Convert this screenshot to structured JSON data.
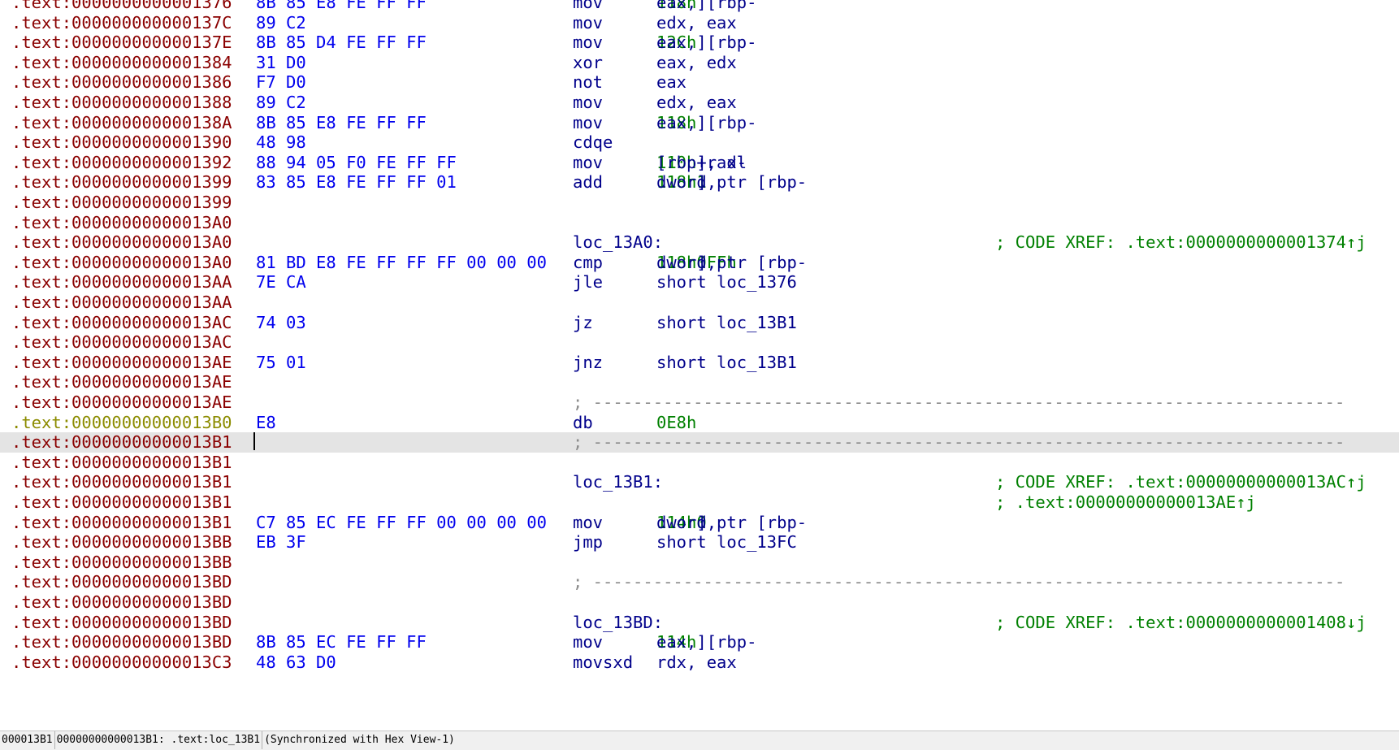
{
  "listing": {
    "rows": [
      {
        "addr": ".text:0000000000001376",
        "bytes": "8B 85 E8 FE FF FF",
        "mnem": "mov",
        "ops": [
          [
            "eax, [rbp-",
            ""
          ],
          [
            "118h",
            "num"
          ],
          [
            "]",
            ""
          ]
        ]
      },
      {
        "addr": ".text:000000000000137C",
        "bytes": "89 C2",
        "mnem": "mov",
        "ops": [
          [
            "edx, eax",
            ""
          ]
        ]
      },
      {
        "addr": ".text:000000000000137E",
        "bytes": "8B 85 D4 FE FF FF",
        "mnem": "mov",
        "ops": [
          [
            "eax, [rbp-",
            ""
          ],
          [
            "12Ch",
            "num"
          ],
          [
            "]",
            ""
          ]
        ]
      },
      {
        "addr": ".text:0000000000001384",
        "bytes": "31 D0",
        "mnem": "xor",
        "ops": [
          [
            "eax, edx",
            ""
          ]
        ]
      },
      {
        "addr": ".text:0000000000001386",
        "bytes": "F7 D0",
        "mnem": "not",
        "ops": [
          [
            "eax",
            ""
          ]
        ]
      },
      {
        "addr": ".text:0000000000001388",
        "bytes": "89 C2",
        "mnem": "mov",
        "ops": [
          [
            "edx, eax",
            ""
          ]
        ]
      },
      {
        "addr": ".text:000000000000138A",
        "bytes": "8B 85 E8 FE FF FF",
        "mnem": "mov",
        "ops": [
          [
            "eax, [rbp-",
            ""
          ],
          [
            "118h",
            "num"
          ],
          [
            "]",
            ""
          ]
        ]
      },
      {
        "addr": ".text:0000000000001390",
        "bytes": "48 98",
        "mnem": "cdqe"
      },
      {
        "addr": ".text:0000000000001392",
        "bytes": "88 94 05 F0 FE FF FF",
        "mnem": "mov",
        "ops": [
          [
            "[rbp+rax-",
            ""
          ],
          [
            "110h",
            "num"
          ],
          [
            "], dl",
            ""
          ]
        ]
      },
      {
        "addr": ".text:0000000000001399",
        "bytes": "83 85 E8 FE FF FF 01",
        "mnem": "add",
        "ops": [
          [
            "dword ptr [rbp-",
            ""
          ],
          [
            "118h",
            "num"
          ],
          [
            "], ",
            ""
          ],
          [
            "1",
            "num"
          ]
        ]
      },
      {
        "addr": ".text:0000000000001399"
      },
      {
        "addr": ".text:00000000000013A0"
      },
      {
        "addr": ".text:00000000000013A0",
        "mnem": "loc_13A0:",
        "comment": "; CODE XREF: .text:0000000000001374↑j"
      },
      {
        "addr": ".text:00000000000013A0",
        "bytes": "81 BD E8 FE FF FF FF 00 00 00",
        "mnem": "cmp",
        "ops": [
          [
            "dword ptr [rbp-",
            ""
          ],
          [
            "118h",
            "num"
          ],
          [
            "], ",
            ""
          ],
          [
            "0FFh",
            "num"
          ]
        ]
      },
      {
        "addr": ".text:00000000000013AA",
        "bytes": "7E CA",
        "mnem": "jle",
        "ops": [
          [
            "short loc_1376",
            ""
          ]
        ]
      },
      {
        "addr": ".text:00000000000013AA"
      },
      {
        "addr": ".text:00000000000013AC",
        "bytes": "74 03",
        "mnem": "jz",
        "ops": [
          [
            "short loc_13B1",
            ""
          ]
        ]
      },
      {
        "addr": ".text:00000000000013AC"
      },
      {
        "addr": ".text:00000000000013AE",
        "bytes": "75 01",
        "mnem": "jnz",
        "ops": [
          [
            "short loc_13B1",
            ""
          ]
        ]
      },
      {
        "addr": ".text:00000000000013AE"
      },
      {
        "addr": ".text:00000000000013AE",
        "sep": "; ---------------------------------------------------------------------------"
      },
      {
        "addr": ".text:00000000000013B0",
        "bytes": "E8",
        "mnem": "db",
        "ops": [
          [
            "0E8h",
            "num"
          ]
        ],
        "style": "yel"
      },
      {
        "addr": ".text:00000000000013B1",
        "sep": "; ---------------------------------------------------------------------------",
        "style": "hl"
      },
      {
        "addr": ".text:00000000000013B1"
      },
      {
        "addr": ".text:00000000000013B1",
        "mnem": "loc_13B1:",
        "comment": "; CODE XREF: .text:00000000000013AC↑j"
      },
      {
        "addr": ".text:00000000000013B1",
        "comment": "; .text:00000000000013AE↑j"
      },
      {
        "addr": ".text:00000000000013B1",
        "bytes": "C7 85 EC FE FF FF 00 00 00 00",
        "mnem": "mov",
        "ops": [
          [
            "dword ptr [rbp-",
            ""
          ],
          [
            "114h",
            "num"
          ],
          [
            "], ",
            ""
          ],
          [
            "0",
            "num"
          ]
        ]
      },
      {
        "addr": ".text:00000000000013BB",
        "bytes": "EB 3F",
        "mnem": "jmp",
        "ops": [
          [
            "short loc_13FC",
            ""
          ]
        ]
      },
      {
        "addr": ".text:00000000000013BB"
      },
      {
        "addr": ".text:00000000000013BD",
        "sep": "; ---------------------------------------------------------------------------"
      },
      {
        "addr": ".text:00000000000013BD"
      },
      {
        "addr": ".text:00000000000013BD",
        "mnem": "loc_13BD:",
        "comment": "; CODE XREF: .text:0000000000001408↓j"
      },
      {
        "addr": ".text:00000000000013BD",
        "bytes": "8B 85 EC FE FF FF",
        "mnem": "mov",
        "ops": [
          [
            "eax, [rbp-",
            ""
          ],
          [
            "114h",
            "num"
          ],
          [
            "]",
            ""
          ]
        ]
      },
      {
        "addr": ".text:00000000000013C3",
        "bytes": "48 63 D0",
        "mnem": "movsxd",
        "ops": [
          [
            "rdx, eax",
            ""
          ]
        ]
      }
    ]
  },
  "statusbar": {
    "offset": "000013B1",
    "location": "00000000000013B1: .text:loc_13B1",
    "sync": "(Synchronized with Hex View-1)"
  },
  "colors": {
    "address": "#8a0000",
    "address_data": "#8c8c00",
    "bytes": "#0000ee",
    "instruction": "#00008b",
    "number": "#008000",
    "comment": "#008000",
    "separator": "#8c8c8c",
    "highlight": "#e4e4e4"
  }
}
